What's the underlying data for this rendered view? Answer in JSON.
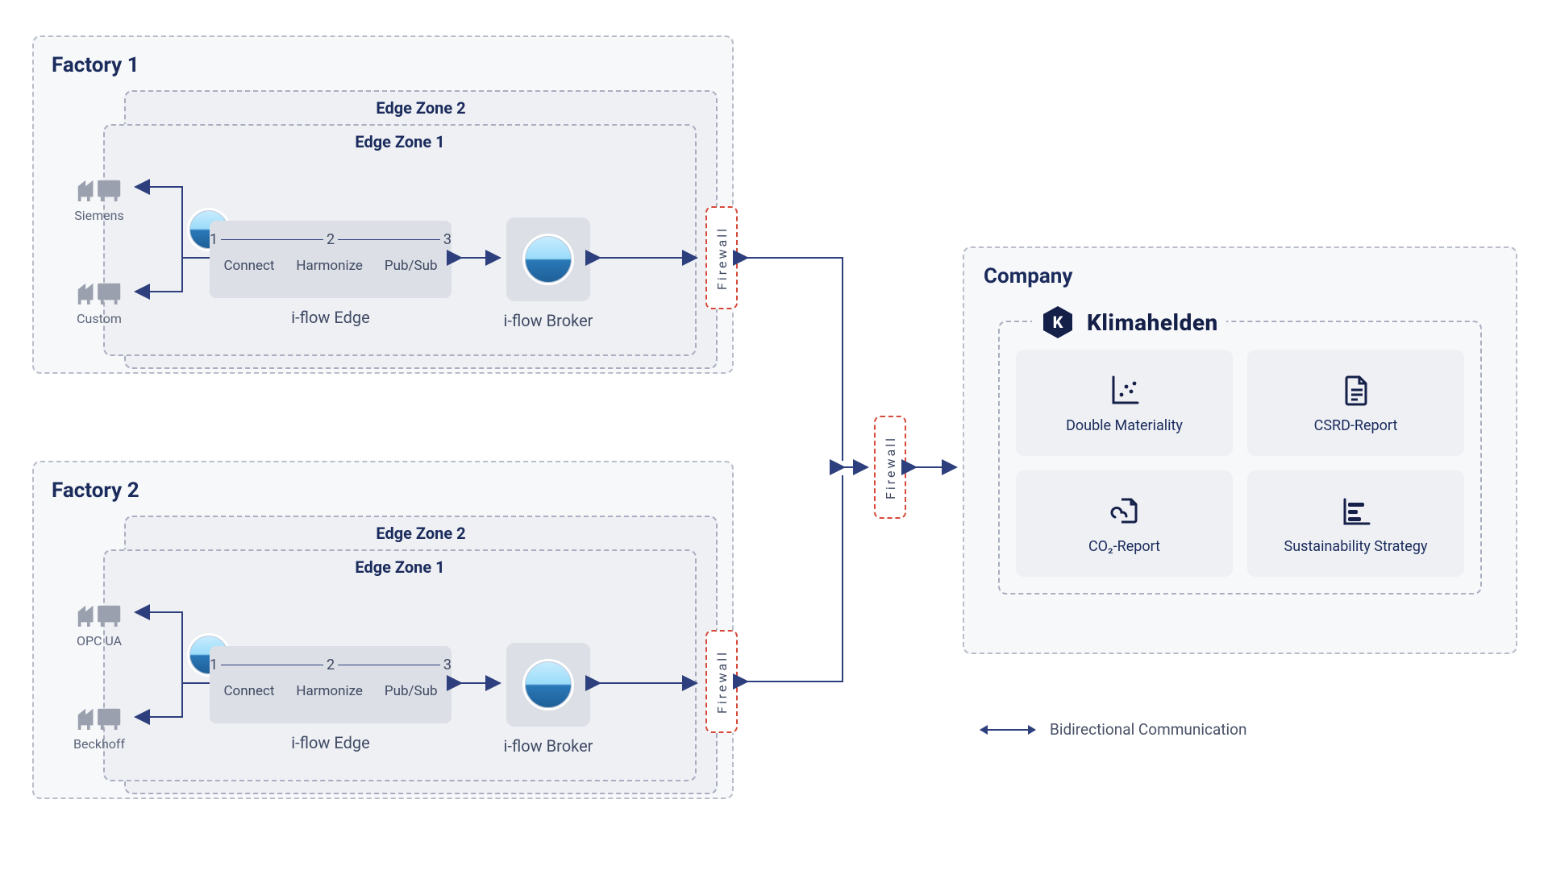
{
  "factories": [
    {
      "title": "Factory 1",
      "edge_zone_outer": "Edge Zone 2",
      "edge_zone_inner": "Edge Zone 1",
      "machines": [
        {
          "label": "Siemens"
        },
        {
          "label": "Custom"
        }
      ],
      "edge": {
        "steps": [
          "1",
          "2",
          "3"
        ],
        "step_labels": [
          "Connect",
          "Harmonize",
          "Pub/Sub"
        ],
        "caption": "i-flow Edge",
        "broker_caption": "i-flow Broker"
      },
      "firewall": "Firewall"
    },
    {
      "title": "Factory 2",
      "edge_zone_outer": "Edge Zone 2",
      "edge_zone_inner": "Edge Zone 1",
      "machines": [
        {
          "label": "OPC UA"
        },
        {
          "label": "Beckhoff"
        }
      ],
      "edge": {
        "steps": [
          "1",
          "2",
          "3"
        ],
        "step_labels": [
          "Connect",
          "Harmonize",
          "Pub/Sub"
        ],
        "caption": "i-flow Edge",
        "broker_caption": "i-flow Broker"
      },
      "firewall": "Firewall"
    }
  ],
  "center_firewall": "Firewall",
  "company": {
    "title": "Company",
    "brand": "Klimahelden",
    "cards": [
      {
        "label": "Double Materiality",
        "icon": "scatter"
      },
      {
        "label": "CSRD-Report",
        "icon": "doc-lines"
      },
      {
        "label": "CO₂-Report",
        "icon": "cloud-doc"
      },
      {
        "label": "Sustainability Strategy",
        "icon": "bars"
      }
    ]
  },
  "legend": {
    "label": "Bidirectional Communication"
  },
  "colors": {
    "accent": "#2e3f7d",
    "firewall": "#d6483a",
    "muted": "#a9afc0"
  }
}
